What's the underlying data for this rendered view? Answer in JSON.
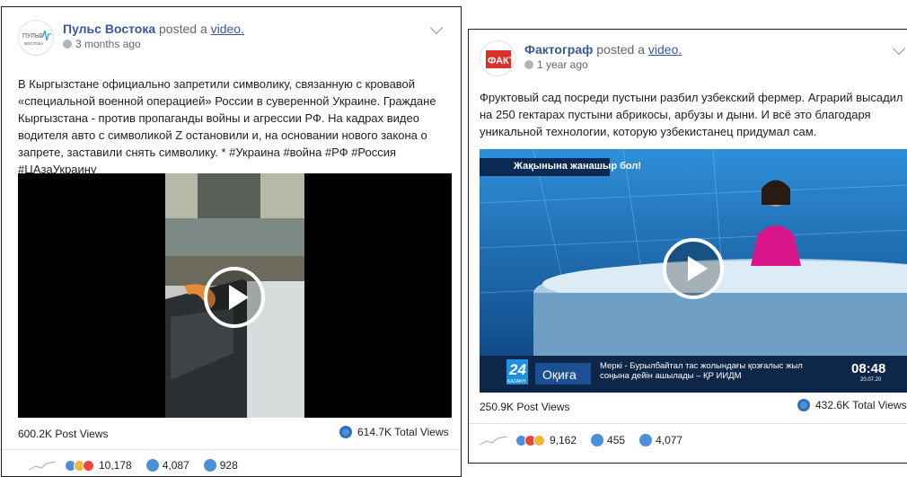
{
  "posts": [
    {
      "page_name": "Пульс Востока",
      "posted_text": " posted a ",
      "video_link": "video.",
      "time": "3 months ago",
      "avatar_text": "ПУЛЬС ВОСТОКА",
      "body": "В Кыргызстане официально запретили символику, связанную с кровавой «специальной военной операцией» России в суверенной Украине. Граждане Кыргызстана - против пропаганды войны и агрессии РФ. На кадрах видео водителя авто с символикой Z остановили и, на основании нового закона о запрете, заставили снять символику. * #Украина #война #РФ #Россия #ЦАзаУкраину",
      "post_views": "600.2K Post Views",
      "total_views": "614.7K Total Views",
      "reactions": "10,178",
      "comments": "4,087",
      "shares": "928"
    },
    {
      "page_name": "Фактограф",
      "posted_text": " posted a ",
      "video_link": "video.",
      "time": "1 year ago",
      "avatar_text": "ФАКТ",
      "body": "Фруктовый сад посреди пустыни разбил узбекский фермер. Аграрий высадил на 250 гектарах пустыни абрикосы, арбузы и дыни. И всё это благодаря уникальной технологии, которую узбекистанец придумал сам.",
      "banner": "Жақынына жанашыр бол!",
      "channel": "24",
      "channel_sub": "KAZAKH",
      "ticker_label": "Оқиға",
      "ticker_text": "Меркі - Бурылбайтал тас жолындағы қозғалыс жыл соңына дейін ашылады – ҚР ИИДМ",
      "clock": "08:48",
      "date": "20.07.20",
      "post_views": "250.9K Post Views",
      "total_views": "432.6K Total Views",
      "reactions": "9,162",
      "comments": "455",
      "shares": "4,077"
    }
  ],
  "colors": {
    "link": "#385898",
    "meta": "#606770",
    "accent_blue": "#4a90d9"
  },
  "icons": [
    "globe-icon",
    "chevron-down-icon",
    "play-icon",
    "total-views-icon",
    "sparkline-icon",
    "comment-icon",
    "share-icon"
  ]
}
